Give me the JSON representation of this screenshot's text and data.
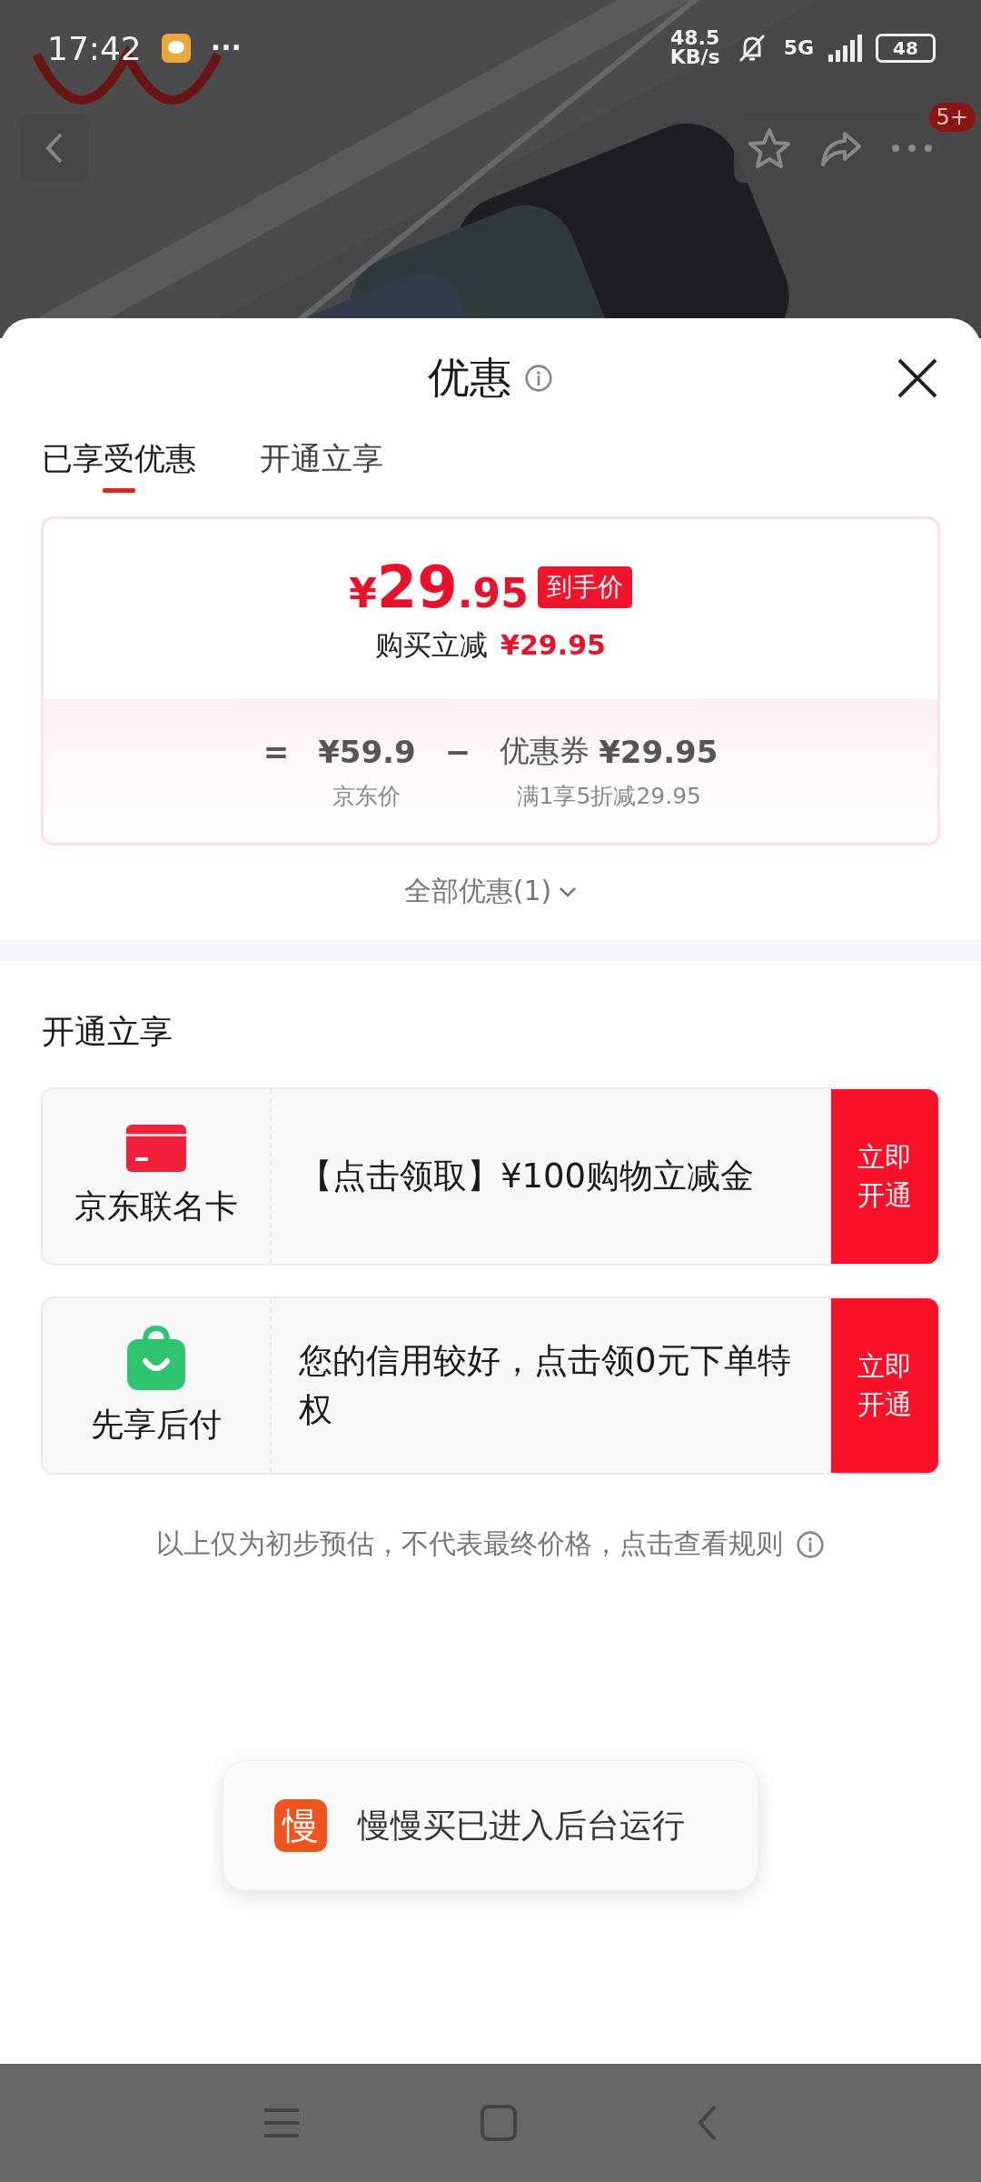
{
  "status_bar": {
    "time": "17:42",
    "more": "···",
    "speed_value": "48.5",
    "speed_unit": "KB/s",
    "network_type": "5G",
    "battery": "48"
  },
  "header": {
    "badge": "5+"
  },
  "sheet": {
    "title": "优惠",
    "tabs": [
      {
        "label": "已享受优惠",
        "selected": true
      },
      {
        "label": "开通立享",
        "selected": false
      }
    ],
    "price_card": {
      "currency": "¥",
      "price_int": "29",
      "price_dec": ".95",
      "price_badge": "到手价",
      "reduction_label": "购买立减",
      "reduction_amount": "¥29.95",
      "breakdown": {
        "equals": "=",
        "base_price": "¥59.9",
        "minus": "−",
        "coupon_label": "优惠券",
        "coupon_amount": "¥29.95",
        "base_caption": "京东价",
        "coupon_caption": "满1享5折减29.95"
      }
    },
    "all_offers": "全部优惠(1)",
    "section_title": "开通立享",
    "offers": [
      {
        "kind": "card",
        "name": "京东联名卡",
        "description": "【点击领取】¥100购物立减金",
        "button": "立即开通"
      },
      {
        "kind": "bag",
        "name": "先享后付",
        "description": "您的信用较好，点击领0元下单特权",
        "button": "立即开通"
      }
    ],
    "note": "以上仅为初步预估，不代表最终价格，点击查看规则"
  },
  "toast": {
    "icon_char": "慢",
    "text": "慢慢买已进入后台运行"
  }
}
